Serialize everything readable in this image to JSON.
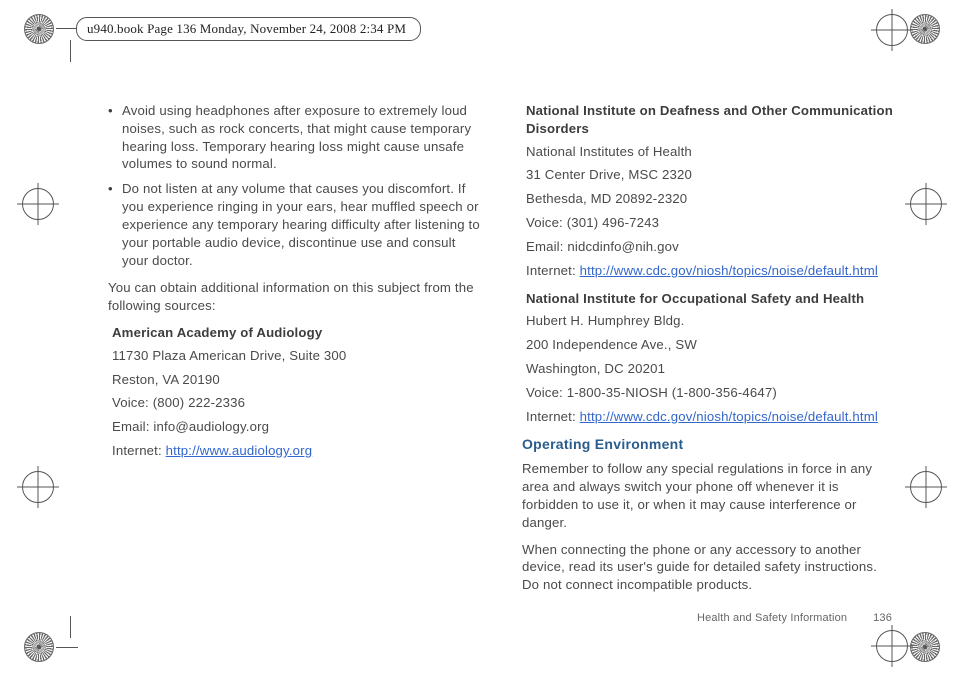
{
  "fm_banner": "u940.book  Page 136  Monday, November 24, 2008  2:34 PM",
  "left": {
    "bullets": [
      "Avoid using headphones after exposure to extremely loud noises, such as rock concerts, that might cause temporary hearing loss. Temporary hearing loss might cause unsafe volumes to sound normal.",
      "Do not listen at any volume that causes you discomfort. If you experience ringing in your ears, hear muffled speech or experience any temporary hearing difficulty after listening to your portable audio device, discontinue use and consult your doctor."
    ],
    "intro": "You can obtain additional information on this subject from the following sources:",
    "org1": {
      "name": "American Academy of Audiology",
      "addr1": "11730 Plaza American Drive, Suite 300",
      "addr2": "Reston, VA 20190",
      "voice": "Voice: (800) 222-2336",
      "email": "Email: info@audiology.org",
      "internet_label": "Internet: ",
      "internet_url": "http://www.audiology.org"
    }
  },
  "right": {
    "org2": {
      "name": "National Institute on Deafness and Other Communication Disorders",
      "line1": "National Institutes of Health",
      "line2": "31 Center Drive, MSC 2320",
      "line3": "Bethesda, MD 20892-2320",
      "voice": "Voice: (301) 496-7243",
      "email": "Email: nidcdinfo@nih.gov",
      "internet_label": "Internet: ",
      "internet_url": "http://www.cdc.gov/niosh/topics/noise/default.html"
    },
    "org3": {
      "name": "National Institute for Occupational Safety and Health",
      "line1": "Hubert H. Humphrey Bldg.",
      "line2": "200 Independence Ave., SW",
      "line3": "Washington, DC 20201",
      "voice": "Voice: 1-800-35-NIOSH (1-800-356-4647)",
      "internet_label": "Internet: ",
      "internet_url": "http://www.cdc.gov/niosh/topics/noise/default.html"
    },
    "heading": "Operating Environment",
    "para1": "Remember to follow any special regulations in force in any area and always switch your phone off whenever it is forbidden to use it, or when it may cause interference or danger.",
    "para2": "When connecting the phone or any accessory to another device, read its user's guide for detailed safety instructions. Do not connect incompatible products."
  },
  "footer": {
    "label": "Health and Safety Information",
    "page": "136"
  }
}
